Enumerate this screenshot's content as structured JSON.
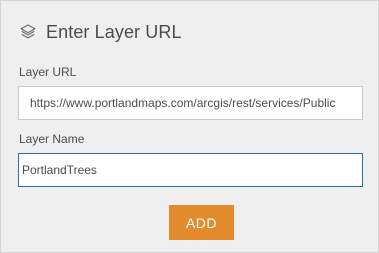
{
  "panel": {
    "title": "Enter Layer URL",
    "title_icon": "layers-icon"
  },
  "form": {
    "url_label": "Layer URL",
    "url_value": "https://www.portlandmaps.com/arcgis/rest/services/Public",
    "name_label": "Layer Name",
    "name_value": "PortlandTrees",
    "add_label": "ADD"
  },
  "colors": {
    "panel_background": "#efefef",
    "accent_button": "#e38a2c",
    "focused_border": "#2b6fa1",
    "text": "#4c4c4c"
  }
}
